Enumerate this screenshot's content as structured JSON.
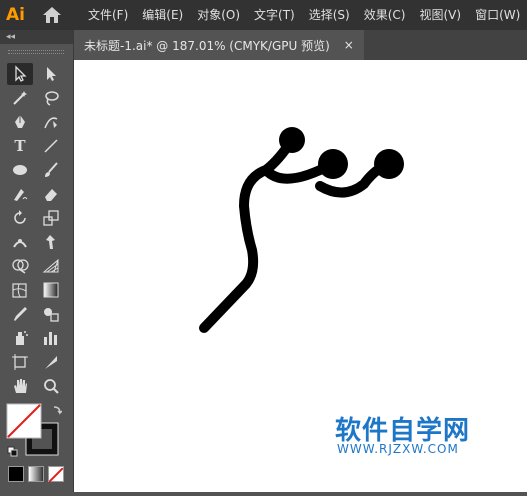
{
  "app": {
    "logo": "Ai",
    "home_icon": "home-icon"
  },
  "menu": [
    "文件(F)",
    "编辑(E)",
    "对象(O)",
    "文字(T)",
    "选择(S)",
    "效果(C)",
    "视图(V)",
    "窗口(W)"
  ],
  "panel": {
    "collapse_icon": "chevron-double-left-icon",
    "collapse_label": "◂◂"
  },
  "tab": {
    "title": "未标题-1.ai* @ 187.01% (CMYK/GPU 预览)",
    "close": "×"
  },
  "tools": [
    "selection-tool-icon",
    "direct-selection-tool-icon",
    "magic-wand-tool-icon",
    "lasso-tool-icon",
    "pen-tool-icon",
    "curvature-tool-icon",
    "type-tool-icon",
    "line-segment-tool-icon",
    "ellipse-tool-icon",
    "paintbrush-tool-icon",
    "shaper-tool-icon",
    "eraser-tool-icon",
    "rotate-tool-icon",
    "scale-tool-icon",
    "width-tool-icon",
    "puppet-warp-tool-icon",
    "shape-builder-tool-icon",
    "perspective-grid-tool-icon",
    "mesh-tool-icon",
    "gradient-tool-icon",
    "eyedropper-tool-icon",
    "blend-tool-icon",
    "symbol-sprayer-tool-icon",
    "column-graph-tool-icon",
    "artboard-tool-icon",
    "slice-tool-icon",
    "hand-tool-icon",
    "zoom-tool-icon"
  ],
  "type_tool_label": "T",
  "colors": {
    "accent": "#FF9A00",
    "watermark": "#1E76C8"
  },
  "watermark": {
    "text": "软件自学网",
    "url": "WWW.RJZXW.COM"
  }
}
